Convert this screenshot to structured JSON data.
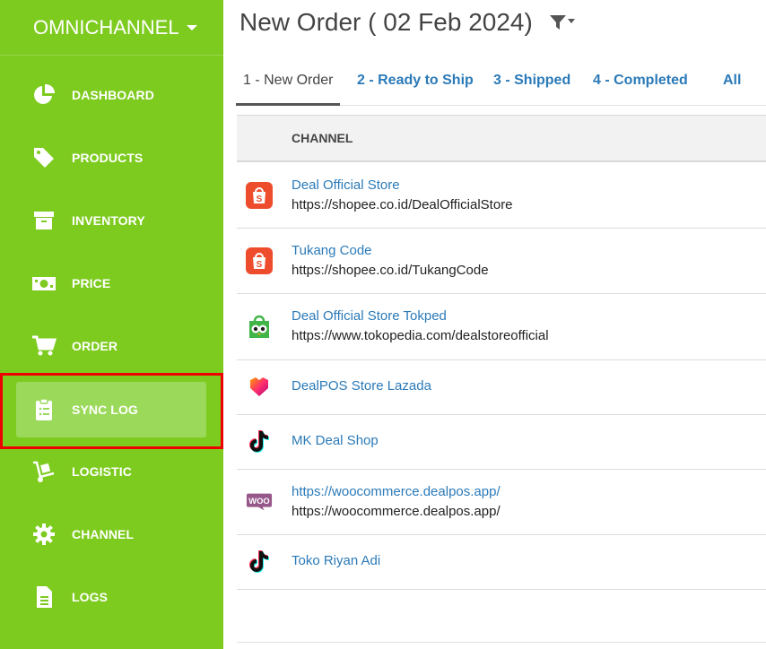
{
  "sidebar": {
    "brand": "OMNICHANNEL",
    "items": [
      {
        "label": "DASHBOARD",
        "icon": "pie-chart-icon"
      },
      {
        "label": "PRODUCTS",
        "icon": "tag-icon"
      },
      {
        "label": "INVENTORY",
        "icon": "archive-icon"
      },
      {
        "label": "PRICE",
        "icon": "money-icon"
      },
      {
        "label": "ORDER",
        "icon": "cart-icon"
      },
      {
        "label": "SYNC LOG",
        "icon": "clipboard-list-icon",
        "active": true
      },
      {
        "label": "LOGISTIC",
        "icon": "dolly-icon"
      },
      {
        "label": "CHANNEL",
        "icon": "gear-icon"
      },
      {
        "label": "LOGS",
        "icon": "file-icon"
      }
    ]
  },
  "header": {
    "title": "New Order ( 02 Feb 2024)",
    "filter_icon": "filter-icon"
  },
  "tabs": [
    {
      "label": "1 - New Order",
      "active": true
    },
    {
      "label": "2 - Ready to Ship"
    },
    {
      "label": "3 - Shipped"
    },
    {
      "label": "4 - Completed"
    },
    {
      "label": "All"
    }
  ],
  "table": {
    "column": "CHANNEL",
    "rows": [
      {
        "name": "Deal Official Store",
        "url": "https://shopee.co.id/DealOfficialStore",
        "platform": "shopee"
      },
      {
        "name": "Tukang Code",
        "url": "https://shopee.co.id/TukangCode",
        "platform": "shopee"
      },
      {
        "name": "Deal Official Store Tokped",
        "url": "https://www.tokopedia.com/dealstoreofficial",
        "platform": "tokopedia"
      },
      {
        "name": "DealPOS Store Lazada",
        "url": "",
        "platform": "lazada"
      },
      {
        "name": "MK Deal Shop",
        "url": "",
        "platform": "tiktok"
      },
      {
        "name": "https://woocommerce.dealpos.app/",
        "url": "https://woocommerce.dealpos.app/",
        "platform": "woocommerce"
      },
      {
        "name": "Toko Riyan Adi",
        "url": "",
        "platform": "tiktok"
      }
    ]
  },
  "colors": {
    "sidebar": "#7ecb20",
    "active_item": "#9bd95a",
    "highlight": "#ee0000",
    "link": "#2b7ab8"
  }
}
